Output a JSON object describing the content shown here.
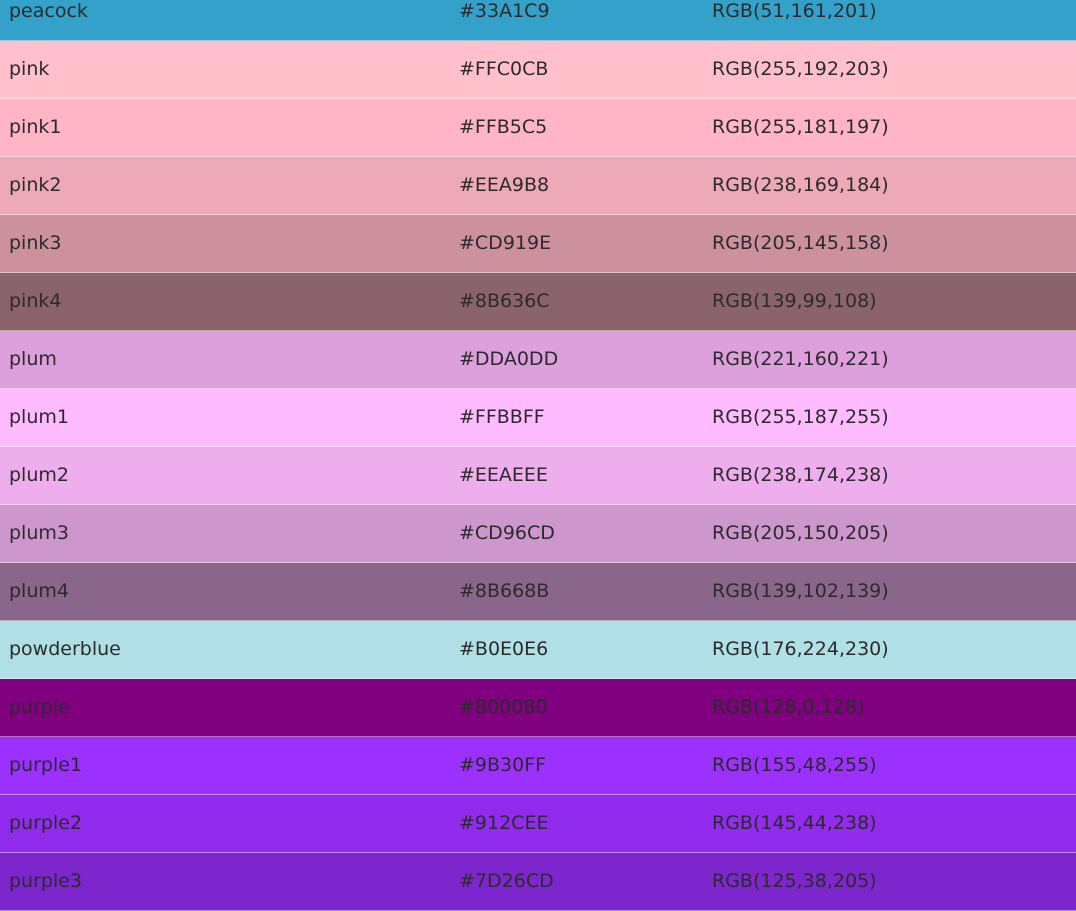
{
  "colors": [
    {
      "name": "peacock",
      "hex": "#33A1C9",
      "rgb": "RGB(51,161,201)",
      "swatch": "#33A1C9"
    },
    {
      "name": "pink",
      "hex": "#FFC0CB",
      "rgb": "RGB(255,192,203)",
      "swatch": "#FFC0CB"
    },
    {
      "name": "pink1",
      "hex": "#FFB5C5",
      "rgb": "RGB(255,181,197)",
      "swatch": "#FFB5C5"
    },
    {
      "name": "pink2",
      "hex": "#EEA9B8",
      "rgb": "RGB(238,169,184)",
      "swatch": "#EEA9B8"
    },
    {
      "name": "pink3",
      "hex": "#CD919E",
      "rgb": "RGB(205,145,158)",
      "swatch": "#CD919E"
    },
    {
      "name": "pink4",
      "hex": "#8B636C",
      "rgb": "RGB(139,99,108)",
      "swatch": "#8B636C"
    },
    {
      "name": "plum",
      "hex": "#DDA0DD",
      "rgb": "RGB(221,160,221)",
      "swatch": "#DDA0DD"
    },
    {
      "name": "plum1",
      "hex": "#FFBBFF",
      "rgb": "RGB(255,187,255)",
      "swatch": "#FFBBFF"
    },
    {
      "name": "plum2",
      "hex": "#EEAEEE",
      "rgb": "RGB(238,174,238)",
      "swatch": "#EEAEEE"
    },
    {
      "name": "plum3",
      "hex": "#CD96CD",
      "rgb": "RGB(205,150,205)",
      "swatch": "#CD96CD"
    },
    {
      "name": "plum4",
      "hex": "#8B668B",
      "rgb": "RGB(139,102,139)",
      "swatch": "#8B668B"
    },
    {
      "name": "powderblue",
      "hex": "#B0E0E6",
      "rgb": "RGB(176,224,230)",
      "swatch": "#B0E0E6"
    },
    {
      "name": "purple",
      "hex": "#800080",
      "rgb": "RGB(128,0,128)",
      "swatch": "#800080"
    },
    {
      "name": "purple1",
      "hex": "#9B30FF",
      "rgb": "RGB(155,48,255)",
      "swatch": "#9B30FF"
    },
    {
      "name": "purple2",
      "hex": "#912CEE",
      "rgb": "RGB(145,44,238)",
      "swatch": "#912CEE"
    },
    {
      "name": "purple3",
      "hex": "#7D26CD",
      "rgb": "RGB(125,38,205)",
      "swatch": "#7D26CD"
    }
  ],
  "text_color": "#2B2B2B",
  "row_divider_color": "#FFFFFF"
}
